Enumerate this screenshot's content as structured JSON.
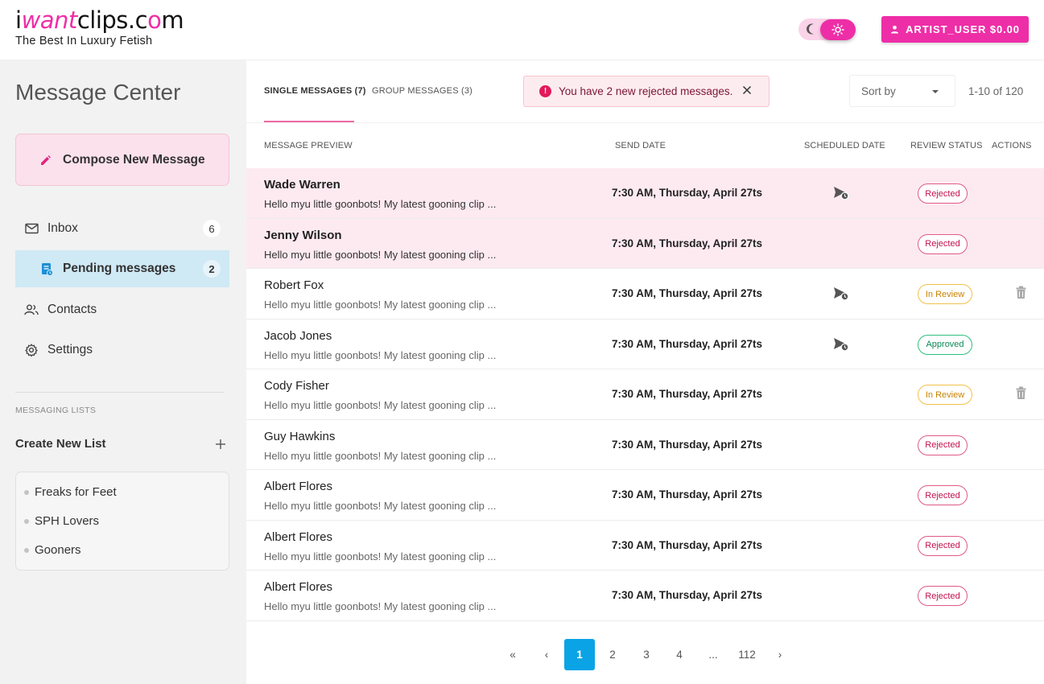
{
  "header": {
    "logo_prefix": "i",
    "logo_pink": "want",
    "logo_mid": "clips.c",
    "logo_o": "o",
    "logo_suffix": "m",
    "tagline": "The Best In Luxury Fetish",
    "user_button": "ARTIST_USER $0.00",
    "icons": {
      "theme_dark": "moon-icon",
      "theme_light": "sun-icon",
      "user": "user-icon"
    }
  },
  "sidebar": {
    "title": "Message Center",
    "compose_label": "Compose New Message",
    "nav": [
      {
        "label": "Inbox",
        "count": "6",
        "icon": "mail-icon"
      },
      {
        "label": "Pending messages",
        "count": "2",
        "icon": "pending-icon"
      },
      {
        "label": "Contacts",
        "icon": "contacts-icon"
      },
      {
        "label": "Settings",
        "icon": "gear-icon"
      }
    ],
    "section_label": "MESSAGING LISTS",
    "create_list_label": "Create New List",
    "lists": [
      "Freaks for Feet",
      "SPH Lovers",
      "Gooners"
    ]
  },
  "tabs": [
    {
      "label": "SINGLE MESSAGES (7)"
    },
    {
      "label": "GROUP MESSAGES (3)"
    }
  ],
  "alert": {
    "text": "You have 2 new rejected messages."
  },
  "sort": {
    "label": "Sort by"
  },
  "range": "1-10 of 120",
  "columns": {
    "preview": "MESSAGE PREVIEW",
    "send_date": "SEND DATE",
    "scheduled_date": "SCHEDULED DATE",
    "review_status": "REVIEW STATUS",
    "actions": "ACTIONS"
  },
  "rows": [
    {
      "name": "Wade Warren",
      "preview": "Hello myu little goonbots! My latest gooning clip ...",
      "send": "7:30 AM, Thursday, April 27ts",
      "scheduled": true,
      "status": "Rejected",
      "trash": false,
      "highlight": true
    },
    {
      "name": "Jenny Wilson",
      "preview": "Hello myu little goonbots! My latest gooning clip ...",
      "send": "7:30 AM, Thursday, April 27ts",
      "scheduled": false,
      "status": "Rejected",
      "trash": false,
      "highlight": true
    },
    {
      "name": "Robert Fox",
      "preview": "Hello myu little goonbots! My latest gooning clip ...",
      "send": "7:30 AM, Thursday, April 27ts",
      "scheduled": true,
      "status": "In Review",
      "trash": true,
      "highlight": false
    },
    {
      "name": "Jacob Jones",
      "preview": "Hello myu little goonbots! My latest gooning clip ...",
      "send": "7:30 AM, Thursday, April 27ts",
      "scheduled": true,
      "status": "Approved",
      "trash": false,
      "highlight": false
    },
    {
      "name": "Cody Fisher",
      "preview": "Hello myu little goonbots! My latest gooning clip ...",
      "send": "7:30 AM, Thursday, April 27ts",
      "scheduled": false,
      "status": "In Review",
      "trash": true,
      "highlight": false
    },
    {
      "name": "Guy Hawkins",
      "preview": "Hello myu little goonbots! My latest gooning clip ...",
      "send": "7:30 AM, Thursday, April 27ts",
      "scheduled": false,
      "status": "Rejected",
      "trash": false,
      "highlight": false
    },
    {
      "name": "Albert Flores",
      "preview": "Hello myu little goonbots! My latest gooning clip ...",
      "send": "7:30 AM, Thursday, April 27ts",
      "scheduled": false,
      "status": "Rejected",
      "trash": false,
      "highlight": false
    },
    {
      "name": "Albert Flores",
      "preview": "Hello myu little goonbots! My latest gooning clip ...",
      "send": "7:30 AM, Thursday, April 27ts",
      "scheduled": false,
      "status": "Rejected",
      "trash": false,
      "highlight": false
    },
    {
      "name": "Albert Flores",
      "preview": "Hello myu little goonbots! My latest gooning clip ...",
      "send": "7:30 AM, Thursday, April 27ts",
      "scheduled": false,
      "status": "Rejected",
      "trash": false,
      "highlight": false
    }
  ],
  "pagination": {
    "first": "«",
    "prev": "‹",
    "pages": [
      "1",
      "2",
      "3",
      "4",
      "...",
      "112"
    ],
    "current": "1",
    "next": "›"
  },
  "colors": {
    "brand_pink": "#ee2ea7",
    "active_page": "#0aa3e6",
    "rejected": "#c3114f",
    "in_review": "#c98300",
    "approved": "#0a8a55"
  }
}
